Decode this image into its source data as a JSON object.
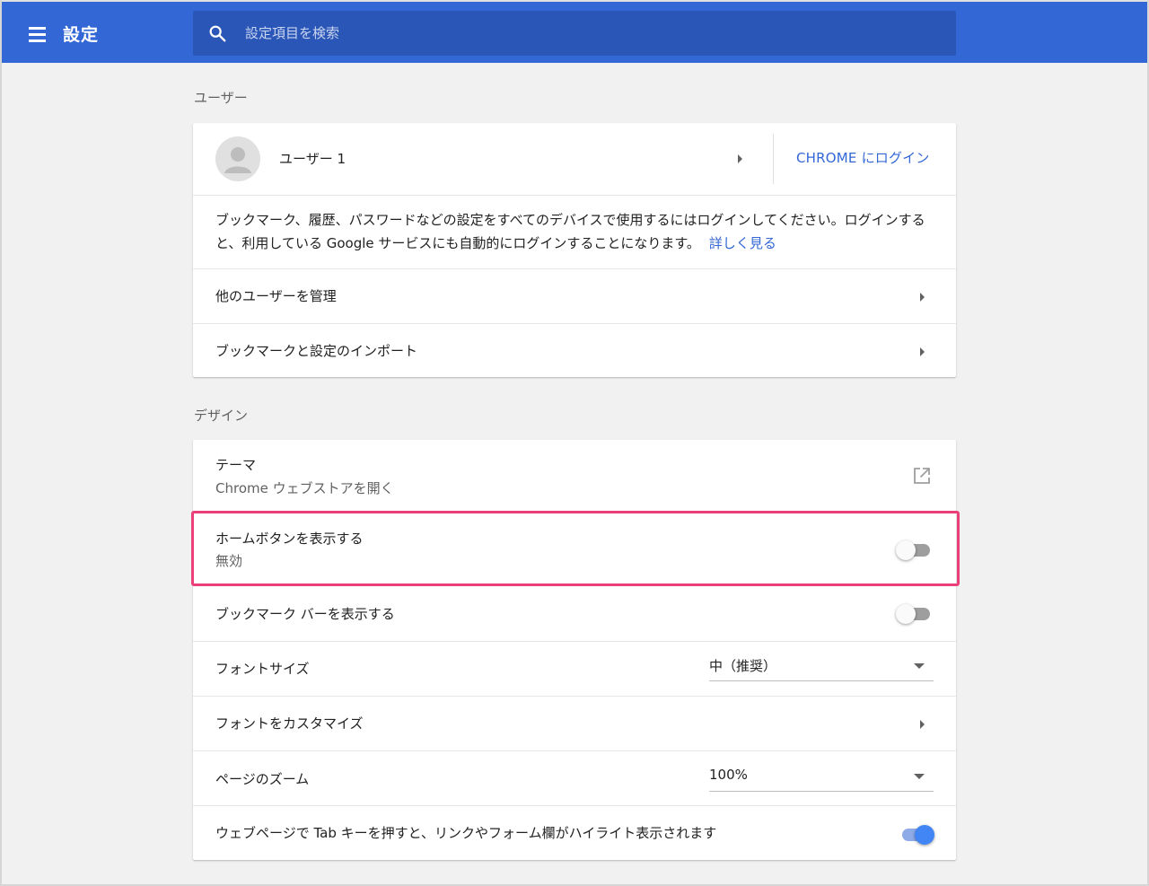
{
  "header": {
    "title": "設定",
    "search_placeholder": "設定項目を検索"
  },
  "users_section": {
    "title": "ユーザー",
    "user_name": "ユーザー 1",
    "login_button": "CHROME にログイン",
    "description": "ブックマーク、履歴、パスワードなどの設定をすべてのデバイスで使用するにはログインしてください。ログインすると、利用している Google サービスにも自動的にログインすることになります。",
    "learn_more": "詳しく見る",
    "manage_users": "他のユーザーを管理",
    "import": "ブックマークと設定のインポート"
  },
  "design_section": {
    "title": "デザイン",
    "theme_label": "テーマ",
    "theme_sub": "Chrome ウェブストアを開く",
    "home_button_label": "ホームボタンを表示する",
    "home_button_sub": "無効",
    "home_button_enabled": false,
    "bookmark_bar_label": "ブックマーク バーを表示する",
    "bookmark_bar_enabled": false,
    "font_size_label": "フォントサイズ",
    "font_size_value": "中（推奨）",
    "customize_fonts_label": "フォントをカスタマイズ",
    "zoom_label": "ページのズーム",
    "zoom_value": "100%",
    "tab_highlight_label": "ウェブページで Tab キーを押すと、リンクやフォーム欄がハイライト表示されます",
    "tab_highlight_enabled": true
  },
  "colors": {
    "header_bg": "#3367d6",
    "accent": "#3367d6",
    "highlight_border": "#eb3f78"
  }
}
